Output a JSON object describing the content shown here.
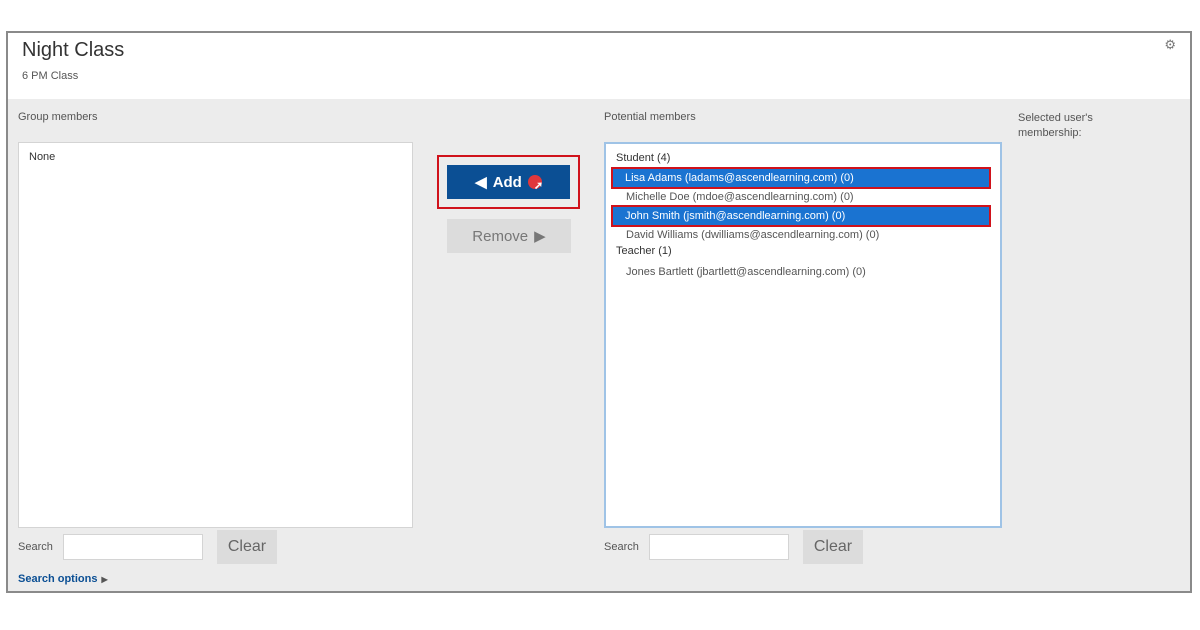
{
  "header": {
    "title": "Night Class",
    "subtitle": "6 PM Class",
    "settings_icon": "gear-icon"
  },
  "group_members": {
    "label": "Group members",
    "empty_text": "None"
  },
  "actions": {
    "add_label": "Add",
    "add_icon": "arrow-left-icon",
    "remove_label": "Remove",
    "remove_icon": "arrow-right-icon"
  },
  "potential_members": {
    "label": "Potential members",
    "groups": [
      {
        "label": "Student (4)",
        "options": [
          {
            "label": "Lisa Adams (ladams@ascendlearning.com) (0)",
            "selected": true
          },
          {
            "label": "Michelle Doe (mdoe@ascendlearning.com) (0)",
            "selected": false
          },
          {
            "label": "John Smith (jsmith@ascendlearning.com) (0)",
            "selected": true
          },
          {
            "label": "David Williams (dwilliams@ascendlearning.com) (0)",
            "selected": false
          }
        ]
      },
      {
        "label": "Teacher (1)",
        "options": [
          {
            "label": "Jones Bartlett (jbartlett@ascendlearning.com) (0)",
            "selected": false
          }
        ]
      }
    ]
  },
  "selected_membership": {
    "label": "Selected user's membership:"
  },
  "left_search": {
    "label": "Search",
    "value": "",
    "clear_label": "Clear"
  },
  "right_search": {
    "label": "Search",
    "value": "",
    "clear_label": "Clear"
  },
  "search_options": {
    "label": "Search options"
  },
  "colors": {
    "primary": "#0b4f94",
    "selection": "#1a73d1",
    "highlight_box": "#d0121b"
  }
}
